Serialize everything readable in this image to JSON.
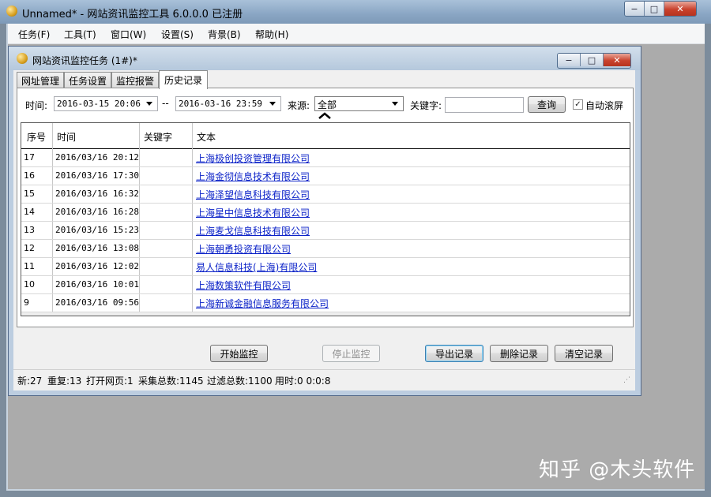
{
  "app": {
    "title": "Unnamed* - 网站资讯监控工具 6.0.0.0  已注册"
  },
  "menubar": [
    {
      "label": "任务(F)"
    },
    {
      "label": "工具(T)"
    },
    {
      "label": "窗口(W)"
    },
    {
      "label": "设置(S)"
    },
    {
      "label": "背景(B)"
    },
    {
      "label": "帮助(H)"
    }
  ],
  "child_window": {
    "title": "网站资讯监控任务  (1#)*"
  },
  "tabs": [
    {
      "label": "网址管理",
      "active": false
    },
    {
      "label": "任务设置",
      "active": false
    },
    {
      "label": "监控报警",
      "active": false
    },
    {
      "label": "历史记录",
      "active": true
    }
  ],
  "filters": {
    "time_label": "时间:",
    "time_from": "2016-03-15 20:06",
    "time_sep": "--",
    "time_to": "2016-03-16 23:59",
    "source_label": "来源:",
    "source_value": "全部",
    "keyword_label": "关键字:",
    "keyword_value": "",
    "query_button": "查询",
    "auto_scroll_label": "自动滚屏",
    "auto_scroll_checked": true
  },
  "table": {
    "headers": [
      "序号",
      "时间",
      "关键字",
      "文本"
    ],
    "rows": [
      {
        "id": "17",
        "time": "2016/03/16 20:12",
        "keyword": "",
        "text": "上海极创投资管理有限公司"
      },
      {
        "id": "16",
        "time": "2016/03/16 17:30",
        "keyword": "",
        "text": "上海金彻信息技术有限公司"
      },
      {
        "id": "15",
        "time": "2016/03/16 16:32",
        "keyword": "",
        "text": "上海泽望信息科技有限公司"
      },
      {
        "id": "14",
        "time": "2016/03/16 16:28",
        "keyword": "",
        "text": "上海星中信息技术有限公司"
      },
      {
        "id": "13",
        "time": "2016/03/16 15:23",
        "keyword": "",
        "text": "上海麦戈信息科技有限公司"
      },
      {
        "id": "12",
        "time": "2016/03/16 13:08",
        "keyword": "",
        "text": "上海朝勇投资有限公司"
      },
      {
        "id": "11",
        "time": "2016/03/16 12:02",
        "keyword": "",
        "text": "易人信息科技(上海)有限公司"
      },
      {
        "id": "10",
        "time": "2016/03/16 10:01",
        "keyword": "",
        "text": "上海数策软件有限公司"
      },
      {
        "id": "9",
        "time": "2016/03/16 09:56",
        "keyword": "",
        "text": "上海新诚金融信息服务有限公司"
      }
    ]
  },
  "actions": {
    "start": "开始监控",
    "stop": "停止监控",
    "export": "导出记录",
    "delete": "删除记录",
    "clear": "清空记录"
  },
  "status": {
    "new": "新:27",
    "repeat": "重复:13",
    "opened": "打开网页:1",
    "collected": "采集总数:1145",
    "filtered": "过滤总数:1100",
    "elapsed": "用时:0 0:0:8"
  },
  "watermark": "知乎 @木头软件",
  "caption_buttons": {
    "minimize": "−",
    "maximize": "□",
    "close": "✕"
  }
}
